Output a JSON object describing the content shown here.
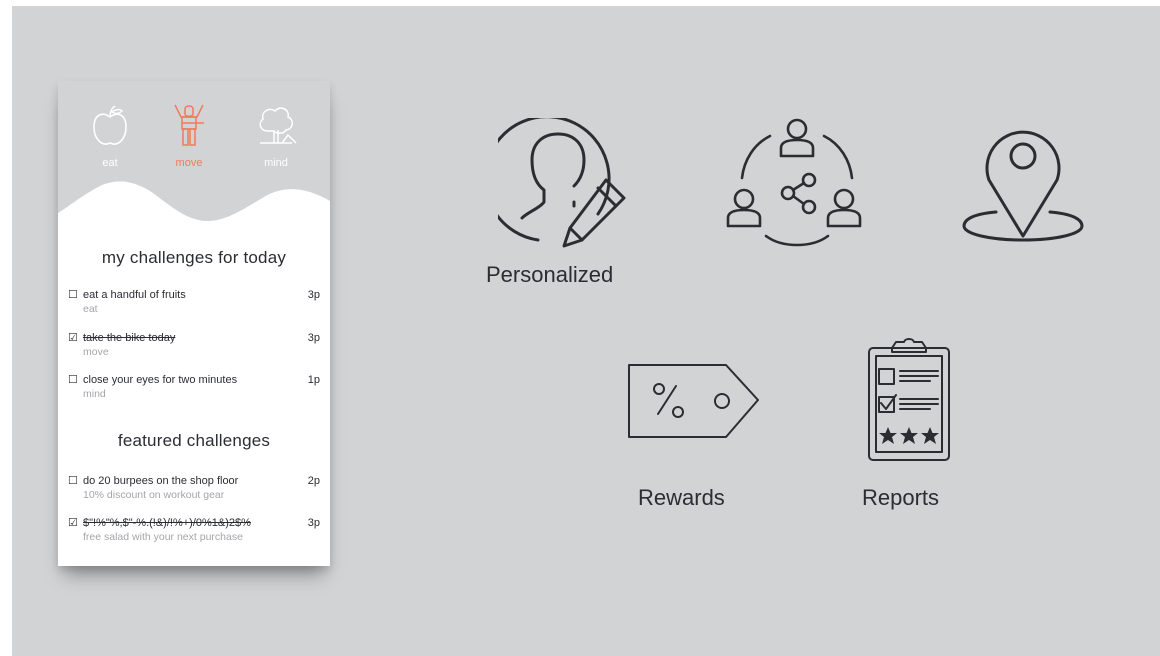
{
  "categories": [
    {
      "label": "eat",
      "icon": "apple-icon",
      "active": false
    },
    {
      "label": "move",
      "icon": "person-exercise-icon",
      "active": true,
      "color": "#f07a5e"
    },
    {
      "label": "mind",
      "icon": "tree-icon",
      "active": false
    }
  ],
  "today": {
    "title": "my challenges for today",
    "items": [
      {
        "title": "eat a handful of fruits",
        "sub": "eat",
        "points": "3p",
        "checked": false
      },
      {
        "title": "take the bike today",
        "sub": "move",
        "points": "3p",
        "checked": true
      },
      {
        "title": "close your eyes for two minutes",
        "sub": "mind",
        "points": "1p",
        "checked": false
      }
    ]
  },
  "featured": {
    "title": "featured challenges",
    "items": [
      {
        "title": "do 20 burpees on the shop floor",
        "sub": "10% discount on workout gear",
        "points": "2p",
        "checked": false
      },
      {
        "title": "$\"!%\"%,$\"-%.(!&)/!%+)/0%1&)2$%",
        "sub": "free salad with your next purchase",
        "points": "3p",
        "checked": true
      }
    ]
  },
  "features": {
    "personalized": {
      "label": "Personalized",
      "icon": "person-edit-icon"
    },
    "share": {
      "icon": "people-share-icon"
    },
    "location": {
      "icon": "location-pin-icon"
    },
    "rewards": {
      "label": "Rewards",
      "icon": "discount-tag-icon"
    },
    "reports": {
      "label": "Reports",
      "icon": "clipboard-report-icon"
    }
  },
  "colors": {
    "background": "#d2d3d5",
    "accent": "#f07a5e",
    "icon_stroke": "#2b2d33"
  }
}
